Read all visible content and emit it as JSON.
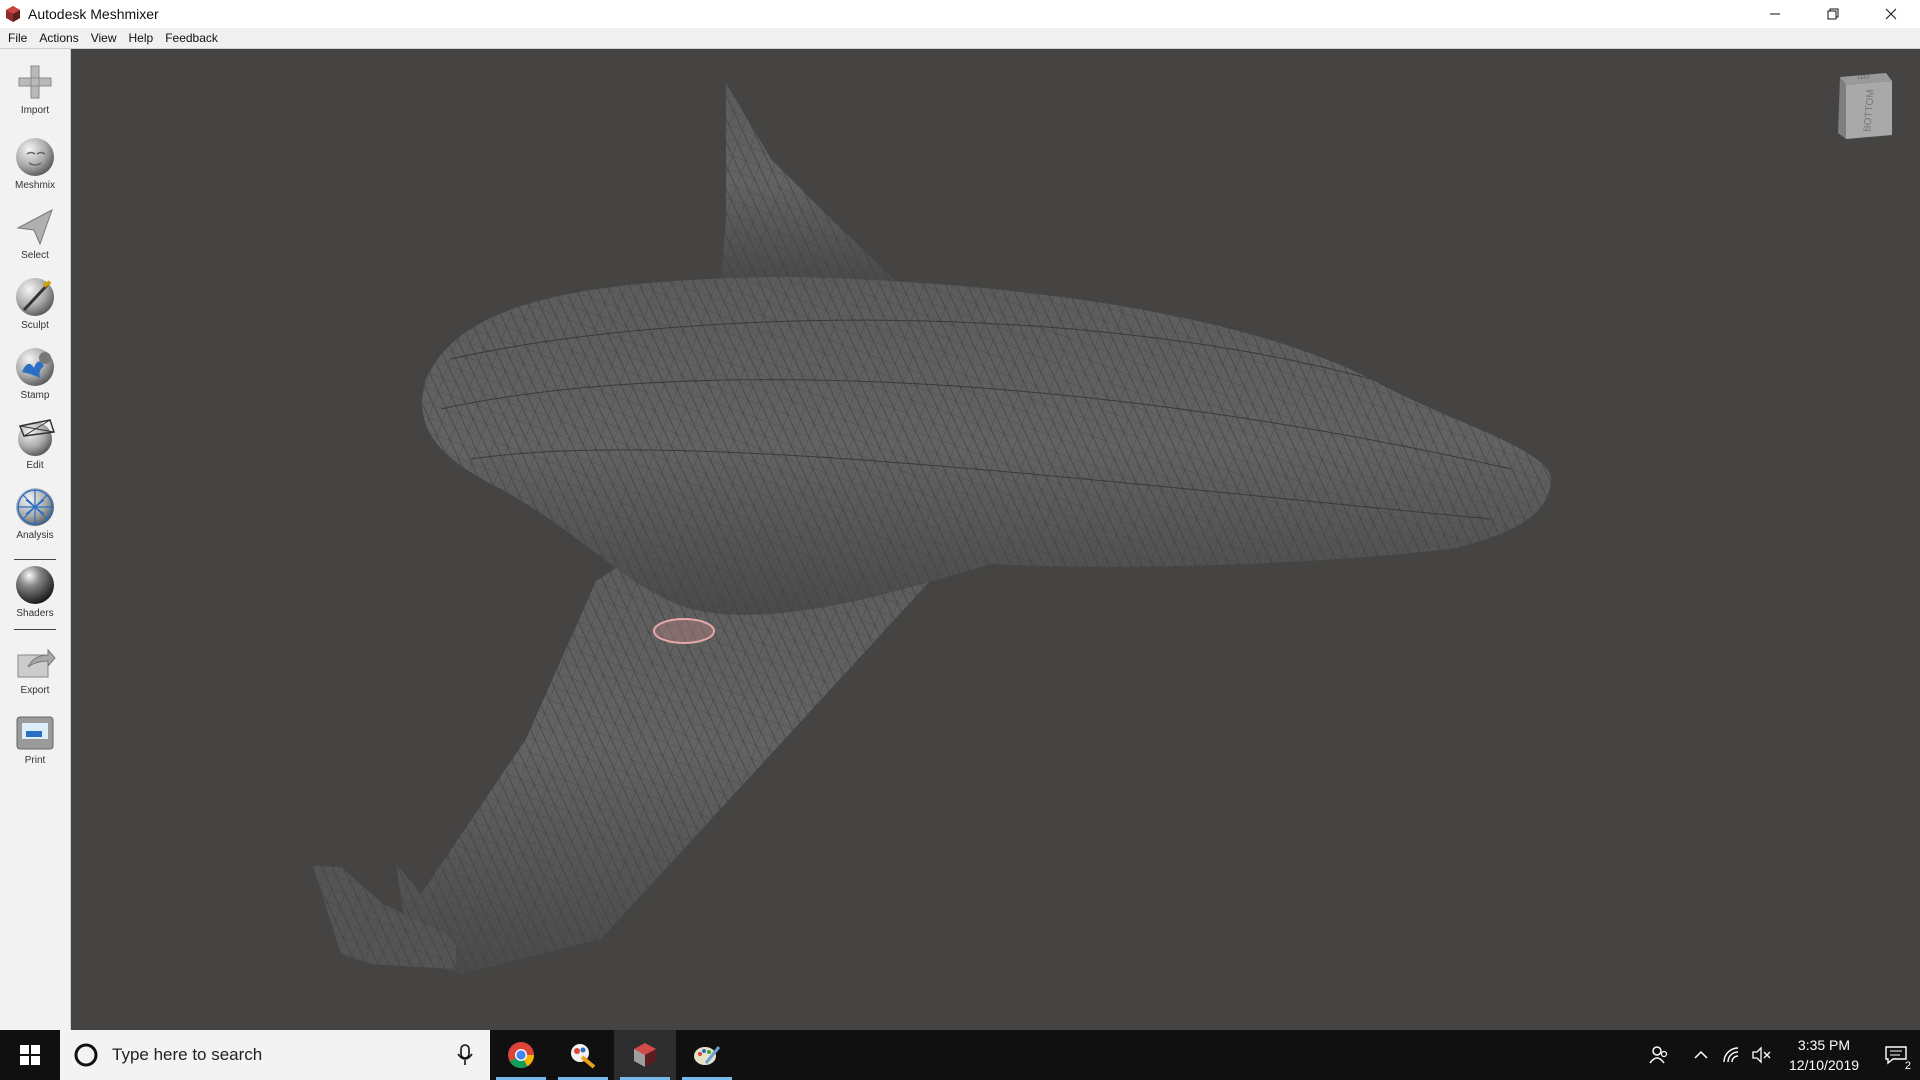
{
  "window": {
    "title": "Autodesk Meshmixer"
  },
  "menu": [
    "File",
    "Actions",
    "View",
    "Help",
    "Feedback"
  ],
  "tools": [
    {
      "label": "Import",
      "icon": "import-icon"
    },
    {
      "label": "Meshmix",
      "icon": "meshmix-icon"
    },
    {
      "label": "Select",
      "icon": "select-icon"
    },
    {
      "label": "Sculpt",
      "icon": "sculpt-icon"
    },
    {
      "label": "Stamp",
      "icon": "stamp-icon"
    },
    {
      "label": "Edit",
      "icon": "edit-icon"
    },
    {
      "label": "Analysis",
      "icon": "analysis-icon"
    },
    {
      "label": "Shaders",
      "icon": "shaders-icon"
    },
    {
      "label": "Export",
      "icon": "export-icon"
    },
    {
      "label": "Print",
      "icon": "print-icon"
    }
  ],
  "viewcube": {
    "face_label": "BOTTOM",
    "top_label": "LEFT"
  },
  "taskbar": {
    "search_placeholder": "Type here to search",
    "apps": [
      "chrome-icon",
      "paint3d-icon",
      "meshmixer-icon",
      "paint-icon"
    ],
    "time": "3:35 PM",
    "date": "12/10/2019",
    "notification_count": "2"
  },
  "colors": {
    "viewport_bg": "#454442",
    "model": "#5b5b5b",
    "brush_cursor": "#e8a8a8",
    "taskbar_bg": "#101010"
  }
}
